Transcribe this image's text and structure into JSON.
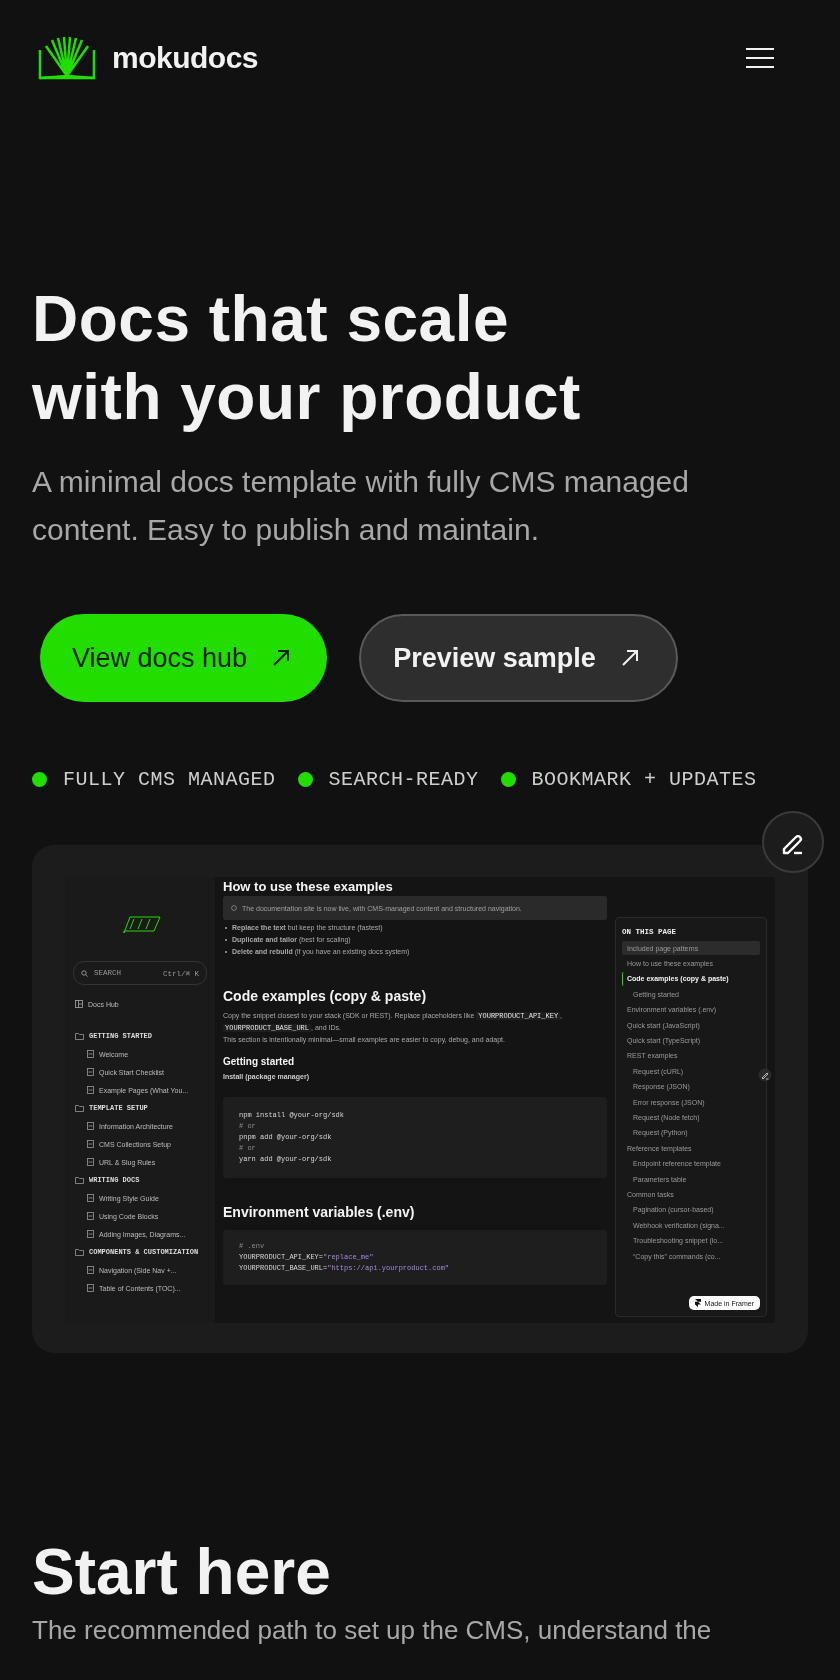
{
  "header": {
    "brand": "mokudocs"
  },
  "hero": {
    "title_lines": [
      "Docs that scale",
      "with your product"
    ],
    "subtitle": "A minimal docs template with fully CMS managed content. Easy to publish and maintain.",
    "buttons": [
      {
        "label": "View docs hub",
        "kind": "primary"
      },
      {
        "label": "Preview sample",
        "kind": "secondary"
      }
    ],
    "features": [
      "FULLY CMS MANAGED",
      "SEARCH-READY",
      "BOOKMARK + UPDATES"
    ]
  },
  "preview": {
    "sidebar": {
      "search_placeholder": "SEARCH",
      "shortcut": "Ctrl/⌘ K",
      "hub": "Docs Hub",
      "groups": [
        {
          "label": "GETTING STARTED",
          "children": [
            "Welcome",
            "Quick Start Checklist",
            "Example Pages (What You..."
          ]
        },
        {
          "label": "TEMPLATE SETUP",
          "children": [
            "Information Architecture",
            "CMS Collections Setup",
            "URL & Slug Rules"
          ]
        },
        {
          "label": "WRITING DOCS",
          "children": [
            "Writing Style Guide",
            "Using Code Blocks",
            "Adding Images, Diagrams..."
          ]
        },
        {
          "label": "COMPONENTS & CUSTOMIZATION",
          "children": [
            "Navigation (Side Nav +...",
            "Table of Contents (TOC)..."
          ]
        }
      ]
    },
    "main": {
      "top_heading": "How to use these examples",
      "notice": "The documentation site is now live, with CMS-managed content and structured navigation.",
      "bullets": [
        "**Replace the text** but keep the structure (fastest)",
        "**Duplicate and tailor** (best for scaling)",
        "**Delete and rebuild** (if you have an existing docs system)"
      ],
      "section_heading": "Code examples (copy & paste)",
      "intro": [
        {
          "text": "Copy the snippet closest to your stack (SDK or REST). Replace placeholders like ",
          "code": false
        },
        {
          "text": "YOURPRODUCT_API_KEY",
          "code": true
        },
        {
          "text": ", ",
          "code": false
        },
        {
          "text": "YOURPRODUCT_BASE_URL",
          "code": true
        },
        {
          "text": ", and IDs.",
          "code": false
        }
      ],
      "note": "This section is intentionally minimal—small examples are easier to copy, debug, and adapt.",
      "sub_heading": "Getting started",
      "label": "Install (package manager)",
      "install_code": [
        {
          "kind": "code",
          "text": "npm install @your-org/sdk"
        },
        {
          "kind": "comment",
          "text": "# or"
        },
        {
          "kind": "code",
          "text": "pnpm add @your-org/sdk"
        },
        {
          "kind": "comment",
          "text": "# or"
        },
        {
          "kind": "code",
          "text": "yarn add @your-org/sdk"
        }
      ],
      "env_heading": "Environment variables (.env)",
      "env_code": [
        {
          "kind": "comment",
          "text": "# .env"
        },
        {
          "kind": "assign",
          "key": "YOURPRODUCT_API_KEY=",
          "value": "\"replace_me\""
        },
        {
          "kind": "assign",
          "key": "YOURPRODUCT_BASE_URL=",
          "value": "\"https://api.yourproduct.com\""
        }
      ]
    },
    "toc": {
      "title": "ON THIS PAGE",
      "items": [
        {
          "label": "Included page patterns",
          "selected": true,
          "active": false
        },
        {
          "label": "How to use these examples",
          "selected": false,
          "active": false
        },
        {
          "label": "Code examples (copy & paste)",
          "selected": false,
          "active": true,
          "children": [
            {
              "label": "Getting started",
              "selected": false,
              "active": false
            }
          ]
        },
        {
          "label": "Environment variables (.env)",
          "selected": false,
          "active": false
        },
        {
          "label": "Quick start (JavaScript)",
          "selected": false,
          "active": false
        },
        {
          "label": "Quick start (TypeScript)",
          "selected": false,
          "active": false
        },
        {
          "label": "REST examples",
          "selected": false,
          "active": false,
          "children": [
            {
              "label": "Request (cURL)",
              "selected": false,
              "active": false
            },
            {
              "label": "Response (JSON)",
              "selected": false,
              "active": false
            },
            {
              "label": "Error response (JSON)",
              "selected": false,
              "active": false
            },
            {
              "label": "Request (Node fetch)",
              "selected": false,
              "active": false
            },
            {
              "label": "Request (Python)",
              "selected": false,
              "active": false
            }
          ]
        },
        {
          "label": "Reference templates",
          "selected": false,
          "active": false,
          "children": [
            {
              "label": "Endpoint reference template",
              "selected": false,
              "active": false
            },
            {
              "label": "Parameters table",
              "selected": false,
              "active": false
            }
          ]
        },
        {
          "label": "Common tasks",
          "selected": false,
          "active": false,
          "children": [
            {
              "label": "Pagination (cursor-based)",
              "selected": false,
              "active": false
            },
            {
              "label": "Webhook verification (signa...",
              "selected": false,
              "active": false
            },
            {
              "label": "Troubleshooting snippet (lo...",
              "selected": false,
              "active": false
            },
            {
              "label": "“Copy this” commands (co...",
              "selected": false,
              "active": false
            }
          ]
        }
      ]
    },
    "badge": "Made in Framer"
  },
  "start": {
    "title": "Start here",
    "text": "The recommended path to set up the CMS, understand the"
  }
}
